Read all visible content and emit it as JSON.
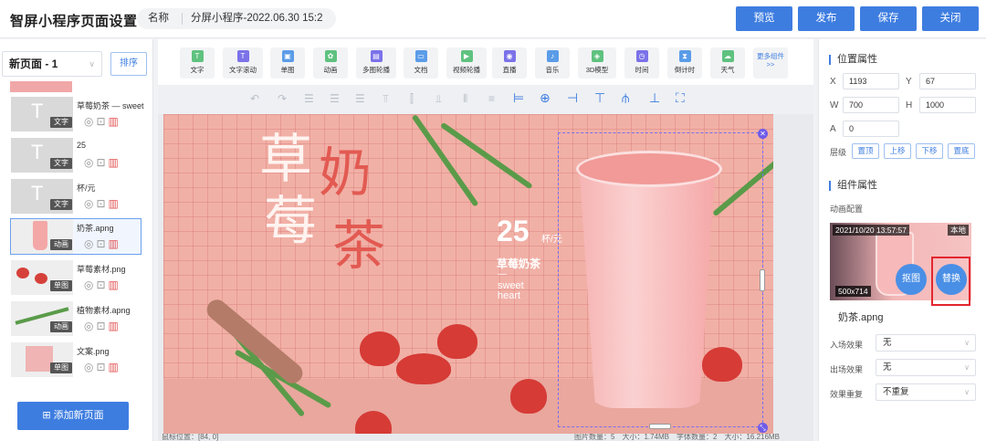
{
  "header": {
    "title": "智屏小程序页面设置",
    "name_label": "名称",
    "name_value": "分屏小程序-2022.06.30 15:2",
    "buttons": {
      "preview": "预览",
      "publish": "发布",
      "save": "保存",
      "close": "关闭"
    }
  },
  "left": {
    "page_select": "新页面 - 1",
    "sort": "排序",
    "add_page": "添加新页面",
    "layers": [
      {
        "name": "草莓奶茶 — sweet heart",
        "badge": "文字"
      },
      {
        "name": "25",
        "badge": "文字"
      },
      {
        "name": "杯/元",
        "badge": "文字"
      },
      {
        "name": "奶茶.apng",
        "badge": "动画"
      },
      {
        "name": "草莓素材.png",
        "badge": "单图"
      },
      {
        "name": "植物素材.apng",
        "badge": "动画"
      },
      {
        "name": "文案.png",
        "badge": "单图"
      }
    ]
  },
  "widgets": [
    "文字",
    "文字滚动",
    "单图",
    "动画",
    "多图轮播",
    "文档",
    "视频轮播",
    "直播",
    "音乐",
    "3D模型",
    "时间",
    "倒计时",
    "天气"
  ],
  "widget_more": "更多组件>>",
  "widget_colors": {
    "purple": "#7b72e9",
    "green": "#5fc27f",
    "blue": "#5b9ce8",
    "pink": "#f08ab0"
  },
  "poster": {
    "chars": {
      "c1": "草",
      "c2": "奶",
      "c3": "莓",
      "c4": "茶"
    },
    "price": "25",
    "unit": "杯/元",
    "drink": "草莓奶茶",
    "dash": "—",
    "sweet1": "sweet",
    "sweet2": "heart"
  },
  "status": {
    "left": "鼠标位置：[84, 0]",
    "right": "图片数量：5　大小：1.74MB　字体数量：2　大小：16.216MB"
  },
  "right": {
    "pos_title": "位置属性",
    "x_label": "X",
    "x_value": "1193",
    "y_label": "Y",
    "y_value": "67",
    "w_label": "W",
    "w_value": "700",
    "h_label": "H",
    "h_value": "1000",
    "a_label": "A",
    "a_value": "0",
    "level_label": "层级",
    "level_buttons": [
      "置顶",
      "上移",
      "下移",
      "置底"
    ],
    "comp_title": "组件属性",
    "anim_config": "动画配置",
    "preview": {
      "date": "2021/10/20 13:57:57",
      "local": "本地",
      "size": "500x714",
      "cutout": "抠图",
      "replace": "替换"
    },
    "file_name": "奶茶.apng",
    "enter_label": "入场效果",
    "enter_value": "无",
    "exit_label": "出场效果",
    "exit_value": "无",
    "repeat_label": "效果重复",
    "repeat_value": "不重复"
  }
}
